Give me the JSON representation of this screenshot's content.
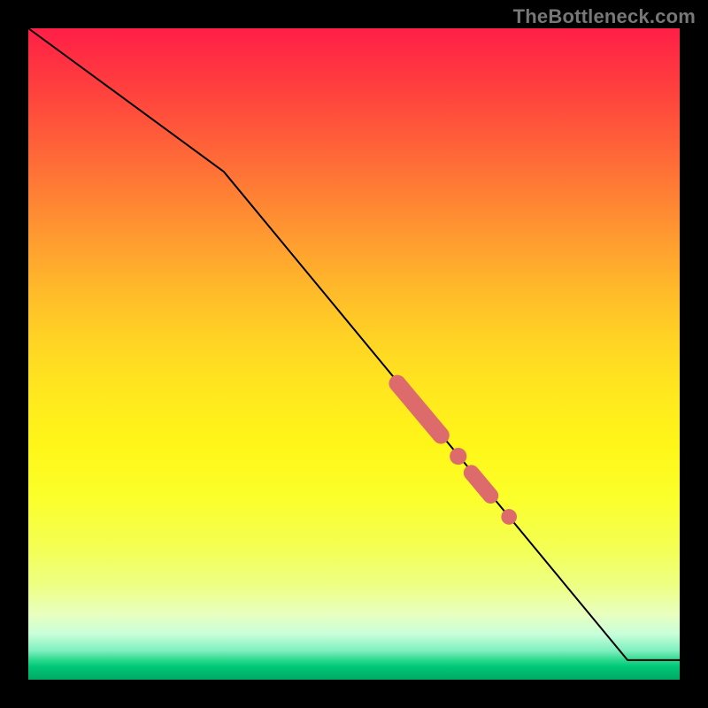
{
  "watermark": "TheBottleneck.com",
  "chart_data": {
    "type": "line",
    "title": "",
    "xlabel": "",
    "ylabel": "",
    "xlim": [
      0,
      100
    ],
    "ylim": [
      0,
      100
    ],
    "grid": false,
    "series": [
      {
        "name": "curve",
        "x": [
          0,
          30,
          92,
          100
        ],
        "y": [
          100,
          78,
          3,
          3
        ]
      }
    ],
    "markers": [
      {
        "shape": "pill",
        "cx": 60.0,
        "cy": 41.5,
        "length": 13.0,
        "width": 2.6,
        "angle_deg": -50
      },
      {
        "shape": "circle",
        "cx": 66.0,
        "cy": 34.3,
        "r": 1.3
      },
      {
        "shape": "pill",
        "cx": 69.5,
        "cy": 30.0,
        "length": 7.0,
        "width": 2.4,
        "angle_deg": -50
      },
      {
        "shape": "circle",
        "cx": 73.8,
        "cy": 25.0,
        "r": 1.2
      }
    ],
    "marker_color": "#dd6b6b",
    "line_color": "#000000",
    "line_width": 2
  }
}
